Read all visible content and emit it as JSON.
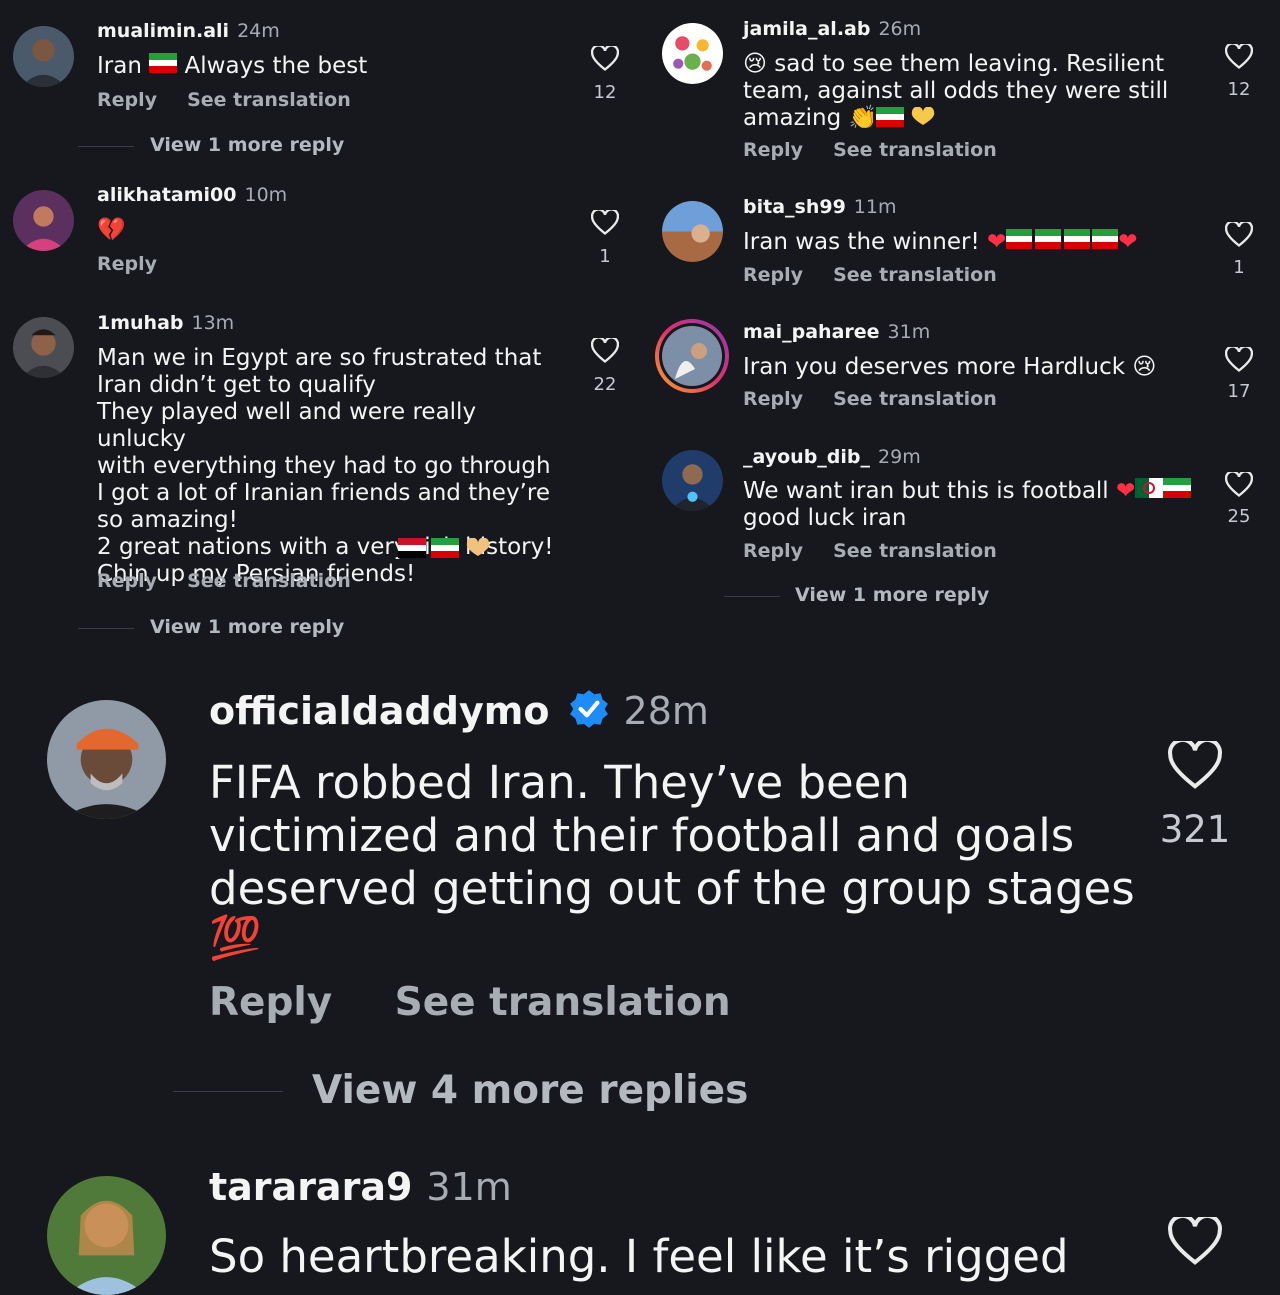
{
  "comments_left": [
    {
      "username": "mualimin.ali",
      "time": "24m",
      "text": "Iran",
      "text_after": " Always the best",
      "reply": "Reply",
      "translate": "See translation",
      "likes": "12",
      "view_more": "View 1 more reply"
    },
    {
      "username": "alikhatami00",
      "time": "10m",
      "text": "💔",
      "reply": "Reply",
      "likes": "1"
    },
    {
      "username": "1muhab",
      "time": "13m",
      "text": "Man we in Egypt are so frustrated that\nIran didn’t get to qualify\nThey played well and were really unlucky\nwith everything they had to go through\nI got a lot of Iranian friends and they’re\nso amazing!\n2 great nations with a very rich history!\nChin up my Persian friends!",
      "reply": "Reply",
      "translate": "See translation",
      "likes": "22",
      "view_more": "View 1 more reply"
    }
  ],
  "comments_right": [
    {
      "username": "jamila_al.ab",
      "time": "26m",
      "text": "😢 sad to see them leaving. Resilient\nteam, against all odds they were still\namazing 👏",
      "reply": "Reply",
      "translate": "See translation",
      "likes": "12"
    },
    {
      "username": "bita_sh99",
      "time": "11m",
      "text": "Iran was the winner!",
      "reply": "Reply",
      "translate": "See translation",
      "likes": "1"
    },
    {
      "username": "mai_paharee",
      "time": "31m",
      "text": "Iran you deserves more Hardluck 😢",
      "reply": "Reply",
      "translate": "See translation",
      "likes": "17"
    },
    {
      "username": "_ayoub_dib_",
      "time": "29m",
      "text": "We want iran but this is football",
      "text_line2": "good luck iran",
      "reply": "Reply",
      "translate": "See translation",
      "likes": "25",
      "view_more": "View 1 more reply"
    }
  ],
  "featured": {
    "username": "officialdaddymo",
    "time": "28m",
    "text": "FIFA robbed Iran. They’ve been\nvictimized and their football and goals\ndeserved getting out of the group stages",
    "emoji": "💯",
    "reply": "Reply",
    "translate": "See translation",
    "likes": "321",
    "view_more": "View 4 more replies"
  },
  "next": {
    "username": "tararara9",
    "time": "31m",
    "text": "So heartbreaking. I feel like it’s rigged"
  },
  "colors": {
    "background": "#16181d",
    "verified": "#1d8cf8",
    "heart_red": "#ff2f45"
  }
}
